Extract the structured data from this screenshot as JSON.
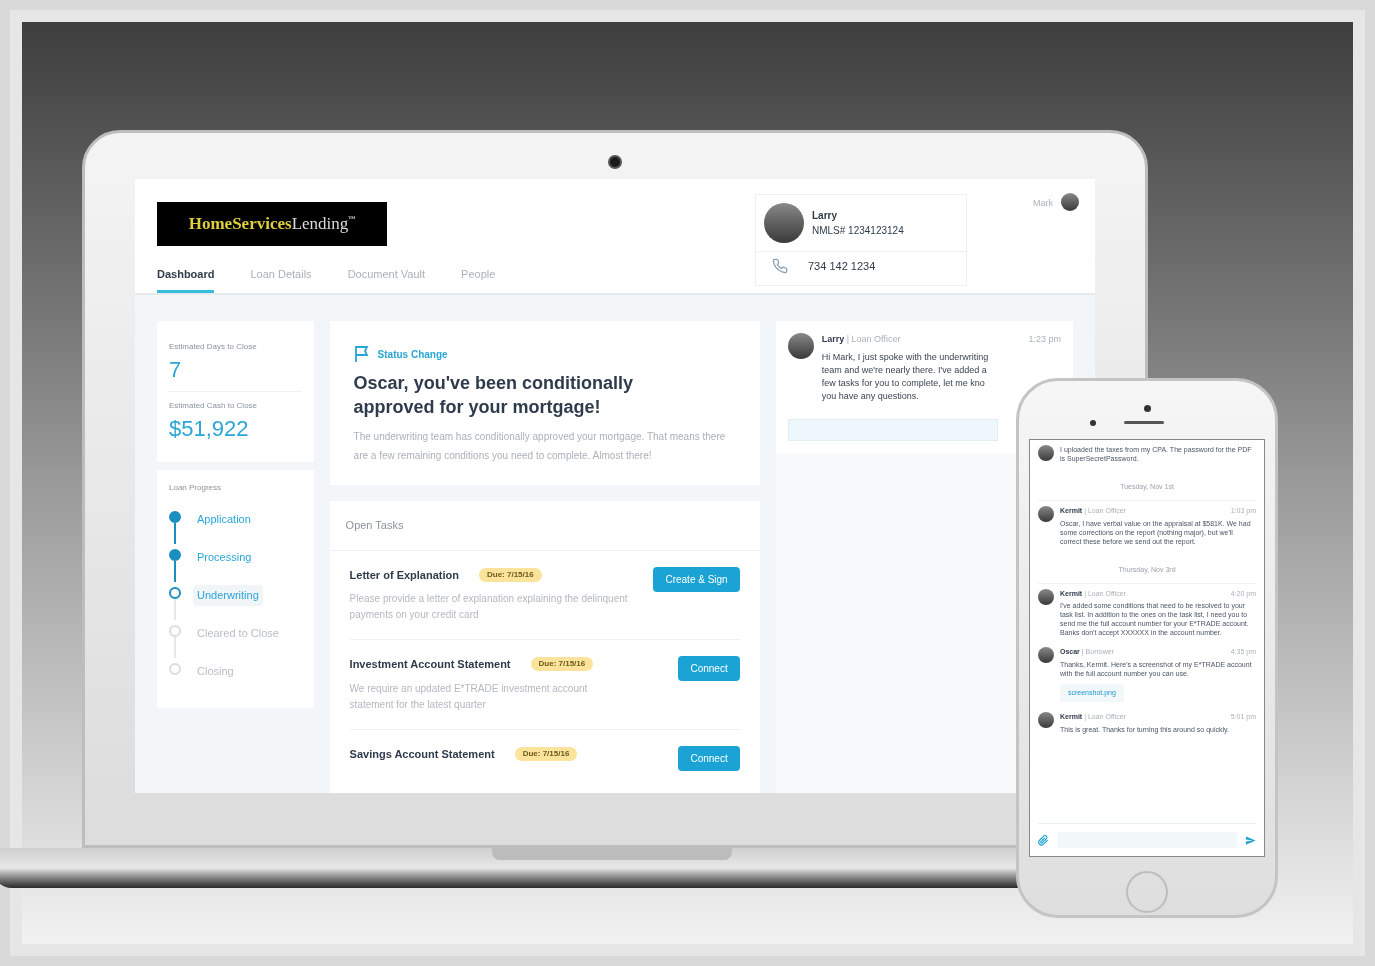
{
  "laptop": {
    "logo": {
      "brand": "HomeServices",
      "suffix": "Lending",
      "mark": "™"
    },
    "tabs": [
      {
        "label": "Dashboard",
        "selected": true
      },
      {
        "label": "Loan Details",
        "selected": false
      },
      {
        "label": "Document Vault",
        "selected": false
      },
      {
        "label": "People",
        "selected": false
      }
    ],
    "contact": {
      "name": "Larry",
      "nmls": "NMLS# 1234123124",
      "phone": "734 142 1234"
    },
    "user": {
      "name": "Mark"
    },
    "stats": [
      {
        "label": "Estimated Days to Close",
        "value": "7"
      },
      {
        "label": "Estimated Cash to Close",
        "value": "$51,922"
      }
    ],
    "progress": {
      "title": "Loan Progress",
      "steps": [
        {
          "label": "Application",
          "kind": "done"
        },
        {
          "label": "Processing",
          "kind": "done"
        },
        {
          "label": "Underwriting",
          "kind": "current"
        },
        {
          "label": "Cleared to Close",
          "kind": "pending"
        },
        {
          "label": "Closing",
          "kind": "pending"
        }
      ]
    },
    "status_card": {
      "tag": "Status Change",
      "headline": "Oscar, you've been conditionally approved for your mortgage!",
      "body": "The underwriting team has conditionally approved your mortgage. That means there are a few remaining conditions you need to complete. Almost there!"
    },
    "tasks": {
      "title": "Open Tasks",
      "items": [
        {
          "title": "Letter of Explanation",
          "due": "Due: 7/15/16",
          "description": "Please provide a letter of explanation explaining the delinquent payments on your credit card",
          "action": "Create & Sign"
        },
        {
          "title": "Investment Account Statement",
          "due": "Due: 7/15/16",
          "description": "We require an updated E*TRADE investment account statement for the latest quarter",
          "action": "Connect"
        },
        {
          "title": "Savings Account Statement",
          "due": "Due: 7/15/16",
          "action": "Connect"
        }
      ]
    },
    "chat": {
      "messages": [
        {
          "sender": "Larry",
          "separator": "|",
          "role": "Loan Officer",
          "time": "1:23 pm",
          "lines": [
            "Hi Mark, I just spoke with the underwriting",
            "team and we're nearly there. I've added a",
            "few tasks for you to complete, let me kno",
            "you have any questions."
          ]
        }
      ]
    }
  },
  "phone": {
    "items": [
      {
        "kind": "message",
        "text": "I uploaded the taxes from my CPA. The password for the PDF is SuperSecretPassword."
      },
      {
        "kind": "date",
        "text": "Tuesday, Nov 1st"
      },
      {
        "kind": "message",
        "sender": "Kermit",
        "separator": "|",
        "role": "Loan Officer",
        "time": "1:03 pm",
        "text": "Oscar, I have verbal value on the appraisal at $581K. We had some corrections on the report (nothing major), but we'll correct these before we send out the report."
      },
      {
        "kind": "date",
        "text": "Thursday, Nov 3rd"
      },
      {
        "kind": "message",
        "sender": "Kermit",
        "separator": "|",
        "role": "Loan Officer",
        "time": "4:20 pm",
        "text": "I've added some conditions that need to be resolved to your task list. In addition to the ones on the task list, I need you to send me the full account number for your E*TRADE account. Banks don't accept XXXXXX in the account number."
      },
      {
        "kind": "message",
        "sender": "Oscar",
        "separator": "|",
        "role": "Borrower",
        "time": "4:35 pm",
        "text": "Thanks, Kermit. Here's a screenshot of my E*TRADE account with the full account number you can use.",
        "attachment": "screenshot.png"
      },
      {
        "kind": "message",
        "sender": "Kermit",
        "separator": "|",
        "role": "Loan Officer",
        "time": "5:01 pm",
        "text": "This is great. Thanks for turning this around so quickly."
      }
    ]
  }
}
